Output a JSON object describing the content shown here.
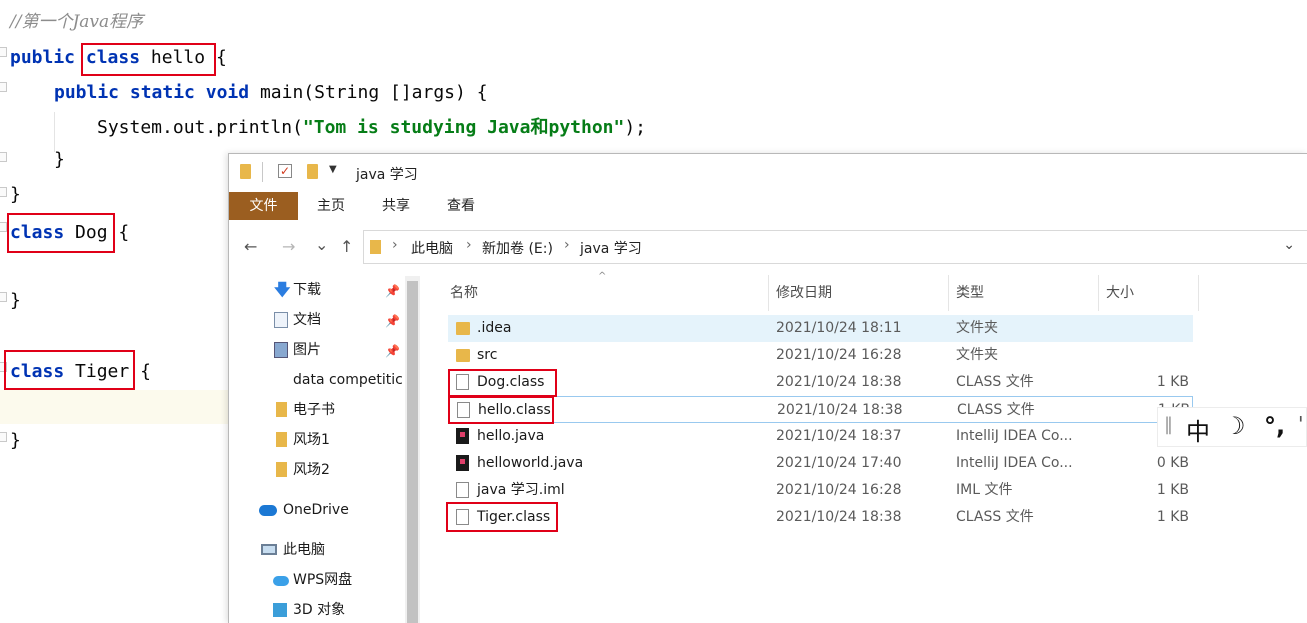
{
  "editor": {
    "comment": "//第一个Java程序",
    "line_public_class": {
      "kw1": "public",
      "kw2": "class",
      "name": "hello",
      "brace": "{"
    },
    "line_main": {
      "kw1": "public",
      "kw2": "static",
      "kw3": "void",
      "rest": "main(String []args) {"
    },
    "line_println": {
      "prefix": "System.out.println(",
      "string": "\"Tom is studying Java和python\"",
      "suffix": ");"
    },
    "close_inner": "}",
    "close_outer": "}",
    "line_dog": {
      "kw": "class",
      "name": "Dog",
      "brace": "{"
    },
    "close_dog": "}",
    "line_tiger": {
      "kw": "class",
      "name": "Tiger",
      "brace": "{"
    },
    "close_tiger": "}"
  },
  "explorer": {
    "title": "java 学习",
    "ribbon_tabs": [
      "文件",
      "主页",
      "共享",
      "查看"
    ],
    "nav_buttons": {
      "back": "←",
      "forward": "→",
      "recent": "⌄",
      "up": "↑"
    },
    "breadcrumb": [
      "此电脑",
      "新加卷 (E:)",
      "java 学习"
    ],
    "breadcrumb_sep": "›",
    "nav_items": [
      {
        "label": "下载",
        "icon": "download-icon",
        "pinned": true
      },
      {
        "label": "文档",
        "icon": "document-icon",
        "pinned": true
      },
      {
        "label": "图片",
        "icon": "pictures-icon",
        "pinned": true
      },
      {
        "label": "data competitic",
        "icon": "folder-icon",
        "pinned": false
      },
      {
        "label": "电子书",
        "icon": "folder-icon",
        "pinned": false
      },
      {
        "label": "风场1",
        "icon": "folder-icon",
        "pinned": false
      },
      {
        "label": "风场2",
        "icon": "folder-icon",
        "pinned": false
      },
      {
        "label": "OneDrive",
        "icon": "onedrive-icon",
        "pinned": false
      },
      {
        "label": "此电脑",
        "icon": "this-pc-icon",
        "pinned": false
      },
      {
        "label": "WPS网盘",
        "icon": "wps-cloud-icon",
        "pinned": false
      },
      {
        "label": "3D 对象",
        "icon": "3d-objects-icon",
        "pinned": false
      }
    ],
    "pin_glyph": "📌",
    "columns": [
      "名称",
      "修改日期",
      "类型",
      "大小"
    ],
    "files": [
      {
        "name": ".idea",
        "date": "2021/10/24 18:11",
        "type": "文件夹",
        "size": "",
        "icon": "folder"
      },
      {
        "name": "src",
        "date": "2021/10/24 16:28",
        "type": "文件夹",
        "size": "",
        "icon": "folder"
      },
      {
        "name": "Dog.class",
        "date": "2021/10/24 18:38",
        "type": "CLASS 文件",
        "size": "1 KB",
        "icon": "file"
      },
      {
        "name": "hello.class",
        "date": "2021/10/24 18:38",
        "type": "CLASS 文件",
        "size": "1 KB",
        "icon": "file"
      },
      {
        "name": "hello.java",
        "date": "2021/10/24 18:37",
        "type": "IntelliJ IDEA Co...",
        "size": "",
        "icon": "idea"
      },
      {
        "name": "helloworld.java",
        "date": "2021/10/24 17:40",
        "type": "IntelliJ IDEA Co...",
        "size": "0 KB",
        "icon": "idea"
      },
      {
        "name": "java 学习.iml",
        "date": "2021/10/24 16:28",
        "type": "IML 文件",
        "size": "1 KB",
        "icon": "file"
      },
      {
        "name": "Tiger.class",
        "date": "2021/10/24 18:38",
        "type": "CLASS 文件",
        "size": "1 KB",
        "icon": "file"
      }
    ]
  },
  "ime": {
    "divider": "‖",
    "lang": "中",
    "moon": "☽",
    "punct": "°,",
    "extra": "'"
  },
  "colors": {
    "highlight_box": "#e00018",
    "keyword": "#0033b3",
    "string": "#067d17",
    "file_tab": "#9b5e20",
    "selection": "#e5f3fb"
  }
}
